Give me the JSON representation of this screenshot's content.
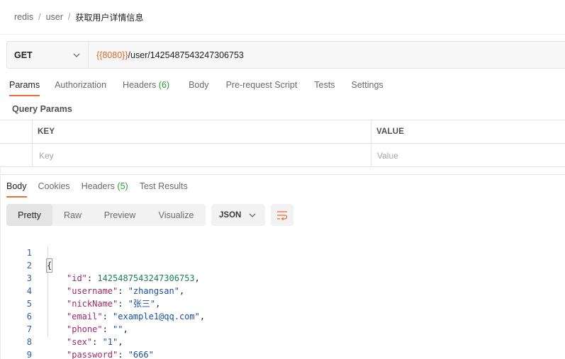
{
  "breadcrumb": {
    "items": [
      "redis",
      "user"
    ],
    "separator": "/",
    "current": "获取用户详情信息"
  },
  "request": {
    "method": "GET",
    "url_variable": "{{8080}}",
    "url_path": "/user/1425487543247306753"
  },
  "request_tabs": {
    "params": "Params",
    "authorization": "Authorization",
    "headers": "Headers",
    "headers_count": "(6)",
    "body": "Body",
    "prerequest": "Pre-request Script",
    "tests": "Tests",
    "settings": "Settings"
  },
  "query_params": {
    "title": "Query Params",
    "key_header": "KEY",
    "value_header": "VALUE",
    "key_placeholder": "Key",
    "value_placeholder": "Value"
  },
  "response_tabs": {
    "body": "Body",
    "cookies": "Cookies",
    "headers": "Headers",
    "headers_count": "(5)",
    "test_results": "Test Results"
  },
  "view_modes": {
    "pretty": "Pretty",
    "raw": "Raw",
    "preview": "Preview",
    "visualize": "Visualize"
  },
  "format": {
    "selected": "JSON"
  },
  "response_body": {
    "line_numbers": [
      "1",
      "2",
      "3",
      "4",
      "5",
      "6",
      "7",
      "8",
      "9"
    ],
    "open_brace": "{",
    "close_brace": "}",
    "fields": [
      {
        "key": "\"id\"",
        "value": "1425487543247306753",
        "kind": "num",
        "comma": ","
      },
      {
        "key": "\"username\"",
        "value": "\"zhangsan\"",
        "kind": "str",
        "comma": ","
      },
      {
        "key": "\"nickName\"",
        "value": "\"张三\"",
        "kind": "str",
        "comma": ","
      },
      {
        "key": "\"email\"",
        "value": "\"example1@qq.com\"",
        "kind": "str",
        "comma": ","
      },
      {
        "key": "\"phone\"",
        "value": "\"\"",
        "kind": "str",
        "comma": ","
      },
      {
        "key": "\"sex\"",
        "value": "\"1\"",
        "kind": "str",
        "comma": ","
      },
      {
        "key": "\"password\"",
        "value": "\"666\"",
        "kind": "str",
        "comma": ""
      }
    ]
  },
  "colors": {
    "accent": "#f26b3a",
    "variable": "#e2692a",
    "count": "#2b9a3a"
  },
  "icons": {
    "method_dropdown": "chevron-down-icon",
    "format_dropdown": "chevron-down-icon",
    "wrap": "wrap-lines-icon"
  }
}
